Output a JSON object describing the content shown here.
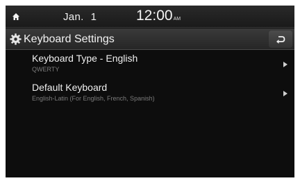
{
  "status": {
    "month": "Jan.",
    "day": "1",
    "time": "12:00",
    "ampm": "AM"
  },
  "header": {
    "title": "Keyboard Settings"
  },
  "items": [
    {
      "title": "Keyboard Type - English",
      "subtitle": "QWERTY"
    },
    {
      "title": "Default Keyboard",
      "subtitle": "English-Latin (For English, French, Spanish)"
    }
  ],
  "icons": {
    "home": "home-icon",
    "settings": "gear-icon",
    "back": "back-arrow-icon",
    "chevron": "chevron-right-icon"
  },
  "colors": {
    "background": "#0d0d0d",
    "text": "#f0f0f0",
    "subtext": "#7c7c7c"
  }
}
